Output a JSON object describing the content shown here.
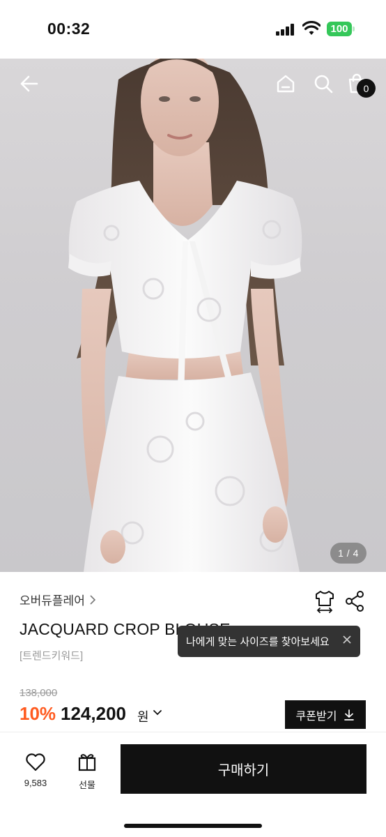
{
  "status": {
    "time": "00:32",
    "battery": "100"
  },
  "header": {
    "cart_count": "0"
  },
  "gallery": {
    "indicator": "1 / 4"
  },
  "product": {
    "brand": "오버듀플레어",
    "title": "JACQUARD CROP BLOUSE",
    "keyword": "[트렌드키워드]",
    "original_price": "138,000",
    "discount": "10%",
    "sale_price": "124,200",
    "currency": "원"
  },
  "tooltip": {
    "text": "나에게 맞는 사이즈를 찾아보세요"
  },
  "coupon": {
    "label": "쿠폰받기"
  },
  "bottom": {
    "likes": "9,583",
    "gift_label": "선물",
    "buy_label": "구매하기"
  },
  "colors": {
    "accent_discount": "#ff5a1f",
    "primary_button": "#111111",
    "tooltip_bg": "#333333",
    "battery": "#34c759"
  },
  "icons": [
    "back-arrow-icon",
    "home-icon",
    "search-icon",
    "cart-icon",
    "size-guide-icon",
    "share-icon",
    "close-icon",
    "chevron-down-icon",
    "download-icon",
    "heart-icon",
    "gift-icon"
  ]
}
